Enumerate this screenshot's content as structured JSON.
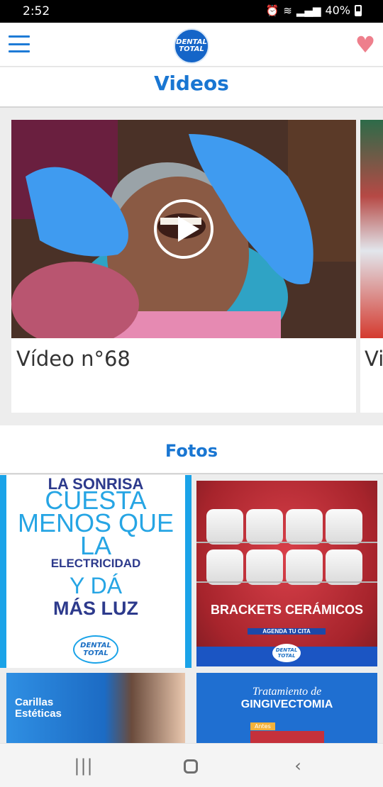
{
  "status_bar": {
    "time": "2:52",
    "battery": "40%"
  },
  "app_bar": {
    "logo_line1": "DENTAL",
    "logo_line2": "TOTAL"
  },
  "videos_section": {
    "title": "Videos",
    "items": [
      {
        "title": "Vídeo n°68"
      },
      {
        "title": "Vi"
      }
    ]
  },
  "photos_section": {
    "title": "Fotos",
    "photo1": {
      "line1": "LA SONRISA",
      "line2": "CUESTA MENOS QUE LA",
      "line3": "ELECTRICIDAD",
      "line4": "Y DÁ",
      "line5": "MÁS LUZ",
      "brand_line1": "DENTAL",
      "brand_line2": "TOTAL"
    },
    "photo2": {
      "line1": "BRACKETS CERÁMICOS",
      "line2": "AGENDA TU CITA",
      "brand_line1": "DENTAL",
      "brand_line2": "TOTAL"
    },
    "photo3": {
      "line1": "Carillas",
      "line2": "Estéticas"
    },
    "photo4": {
      "line1": "Tratamiento de",
      "line2": "GINGIVECTOMIA",
      "tag": "Antes"
    }
  }
}
